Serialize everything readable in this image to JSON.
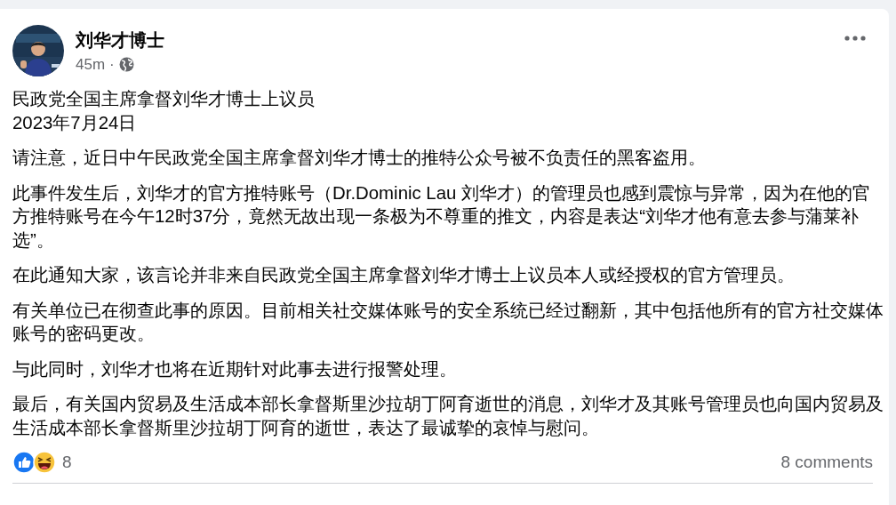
{
  "post": {
    "author": "刘华才博士",
    "time": "45m",
    "separator": "·",
    "heading_lines": [
      "民政党全国主席拿督刘华才博士上议员",
      "2023年7月24日"
    ],
    "paragraphs": [
      "请注意，近日中午民政党全国主席拿督刘华才博士的推特公众号被不负责任的黑客盗用。",
      "此事件发生后，刘华才的官方推特账号（Dr.Dominic Lau 刘华才）的管理员也感到震惊与异常，因为在他的官方推特账号在今午12时37分，竟然无故出现一条极为不尊重的推文，内容是表达“刘华才他有意去参与蒲莱补选”。",
      "在此通知大家，该言论并非来自民政党全国主席拿督刘华才博士上议员本人或经授权的官方管理员。",
      "有关单位已在彻查此事的原因。目前相关社交媒体账号的安全系统已经过翻新，其中包括他所有的官方社交媒体账号的密码更改。",
      "与此同时，刘华才也将在近期针对此事去进行报警处理。",
      "最后，有关国内贸易及生活成本部长拿督斯里沙拉胡丁阿育逝世的消息，刘华才及其账号管理员也向国内贸易及生活成本部长拿督斯里沙拉胡丁阿育的逝世，表达了最诚挚的哀悼与慰问。"
    ],
    "reactions": [
      {
        "kind": "like"
      },
      {
        "kind": "haha"
      }
    ],
    "reaction_count": "8",
    "comments": "8 comments"
  }
}
